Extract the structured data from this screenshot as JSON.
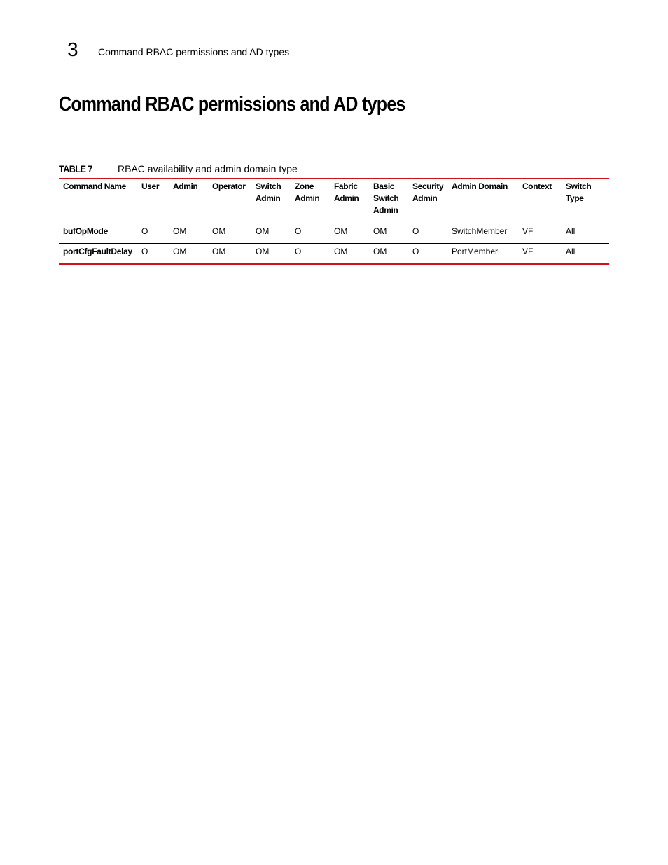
{
  "header": {
    "chapter_number": "3",
    "running_title": "Command RBAC permissions and AD types"
  },
  "page_title": "Command RBAC permissions and AD types",
  "table": {
    "label": "TABLE 7",
    "caption": "RBAC availability and admin domain type",
    "columns": [
      "Command Name",
      "User",
      "Admin",
      "Operator",
      "Switch Admin",
      "Zone Admin",
      "Fabric Admin",
      "Basic Switch Admin",
      "Security Admin",
      "Admin Domain",
      "Context",
      "Switch Type"
    ],
    "rows": [
      [
        "bufOpMode",
        "O",
        "OM",
        "OM",
        "OM",
        "O",
        "OM",
        "OM",
        "O",
        "SwitchMember",
        "VF",
        "All"
      ],
      [
        "portCfgFaultDelay",
        "O",
        "OM",
        "OM",
        "OM",
        "O",
        "OM",
        "OM",
        "O",
        "PortMember",
        "VF",
        "All"
      ]
    ]
  }
}
